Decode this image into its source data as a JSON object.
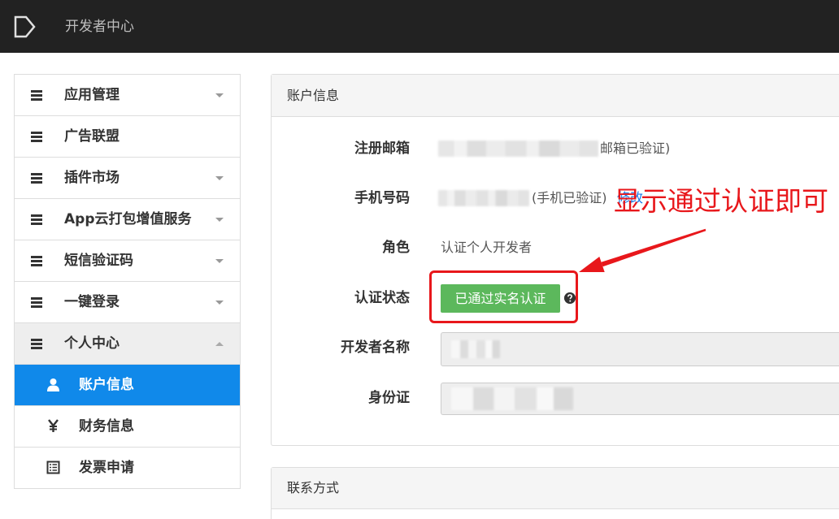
{
  "topbar": {
    "title": "开发者中心",
    "logo_icon": "logo-icon",
    "background": "#222222"
  },
  "sidebar": {
    "items": [
      {
        "label": "应用管理",
        "icon": "menu-icon",
        "caret_icon": "chevron-down-icon"
      },
      {
        "label": "广告联盟",
        "icon": "menu-icon"
      },
      {
        "label": "插件市场",
        "icon": "menu-icon",
        "caret_icon": "chevron-down-icon"
      },
      {
        "label": "App云打包增值服务",
        "icon": "menu-icon",
        "caret_icon": "chevron-down-icon"
      },
      {
        "label": "短信验证码",
        "icon": "menu-icon",
        "caret_icon": "chevron-down-icon"
      },
      {
        "label": "一键登录",
        "icon": "menu-icon",
        "caret_icon": "chevron-down-icon"
      },
      {
        "label": "个人中心",
        "icon": "menu-icon",
        "caret_icon": "chevron-up-icon",
        "expanded": true
      }
    ],
    "subitems": [
      {
        "label": "账户信息",
        "icon": "user-icon",
        "active": true
      },
      {
        "label": "财务信息",
        "icon": "yen-icon"
      },
      {
        "label": "发票申请",
        "icon": "invoice-list-icon"
      }
    ],
    "active_color": "#1089ea"
  },
  "account_panel": {
    "title": "账户信息",
    "email": {
      "label": "注册邮箱",
      "status": "邮箱已验证)"
    },
    "phone": {
      "label": "手机号码",
      "status": "(手机已验证)",
      "edit_link": "修改"
    },
    "role": {
      "label": "角色",
      "value": "认证个人开发者"
    },
    "verification": {
      "label": "认证状态",
      "badge": "已通过实名认证",
      "badge_color": "#5cb85c",
      "help_icon": "question-circle-icon"
    },
    "developer_name": {
      "label": "开发者名称"
    },
    "id_card": {
      "label": "身份证"
    }
  },
  "contact_panel": {
    "title": "联系方式"
  },
  "annotation": {
    "text": "显示通过认证即可",
    "color": "#e8171b",
    "arrow_icon": "red-arrow-icon"
  }
}
